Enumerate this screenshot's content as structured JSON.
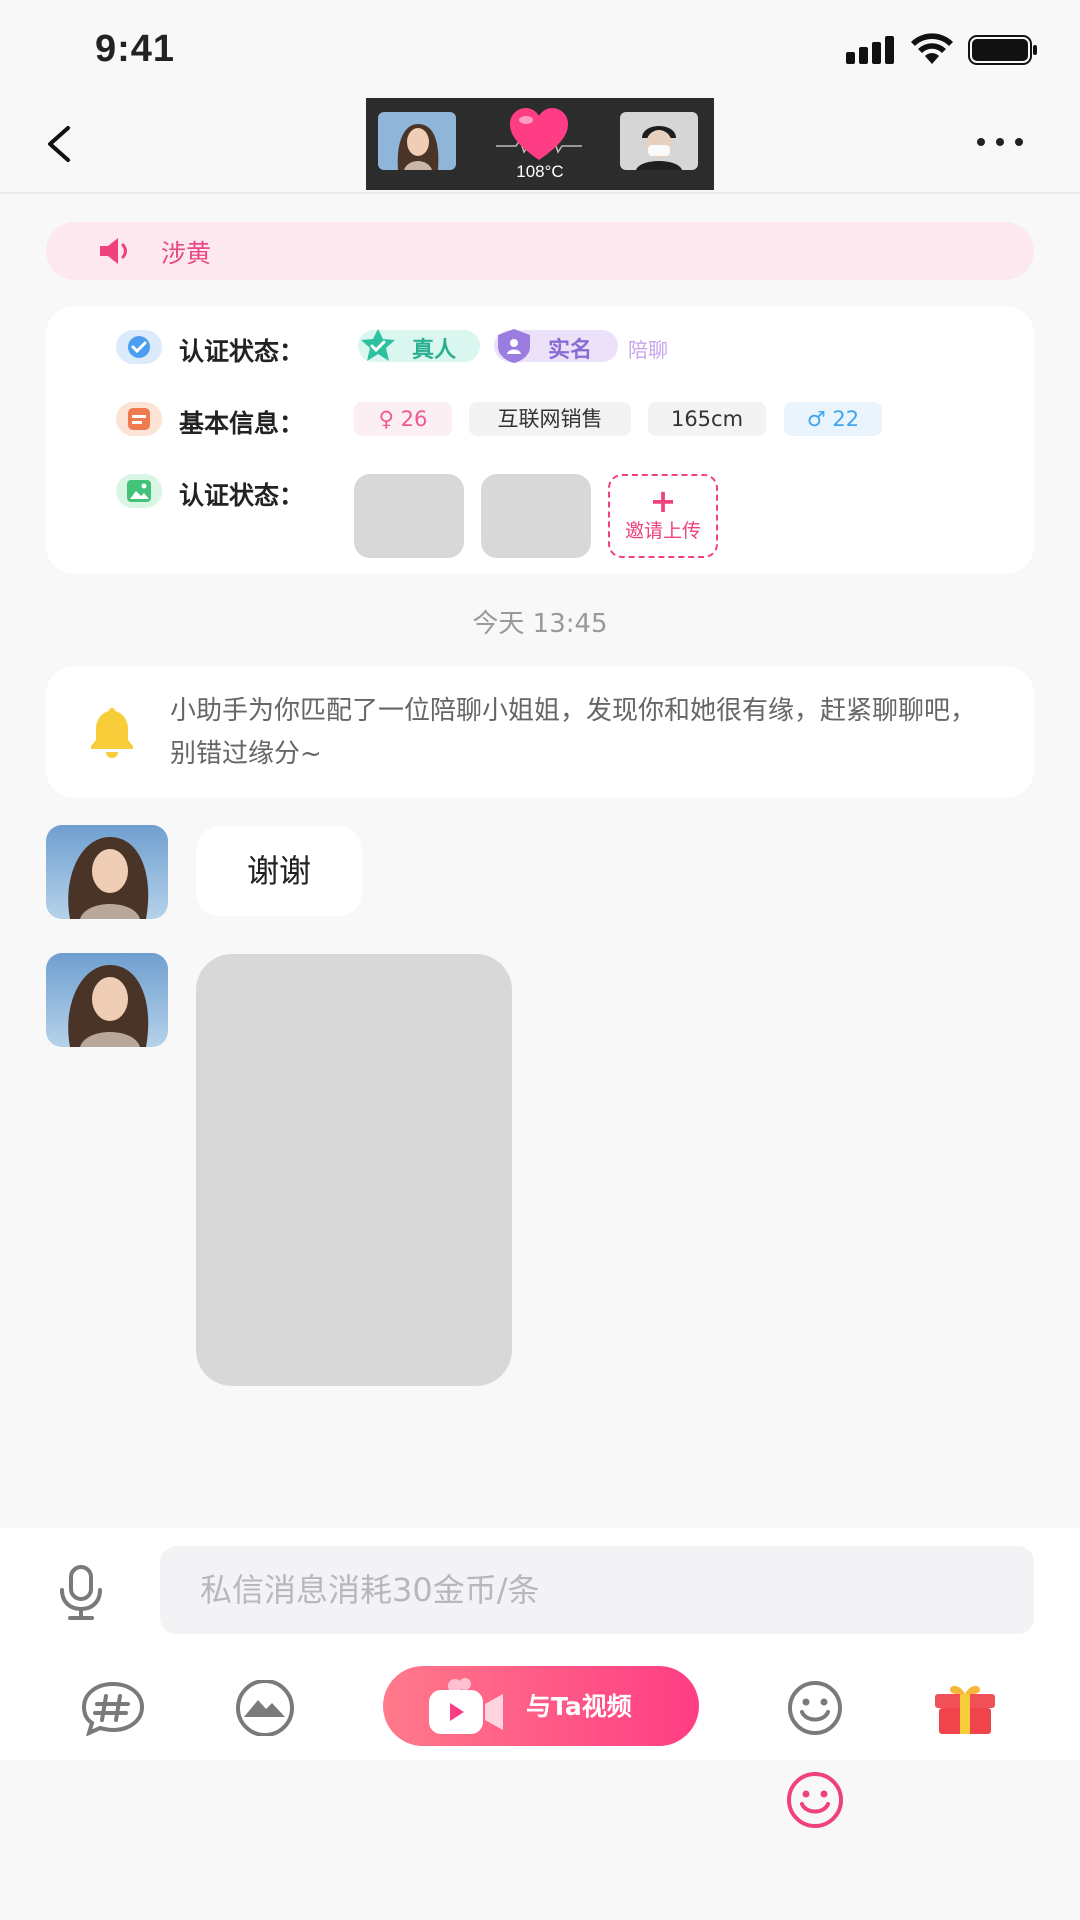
{
  "status_bar": {
    "time": "9:41"
  },
  "nav": {
    "temperature": "108°C"
  },
  "notice": {
    "text": "涉黄"
  },
  "info_card": {
    "rows": [
      {
        "label": "认证状态："
      },
      {
        "label": "基本信息："
      },
      {
        "label": "认证状态："
      }
    ],
    "badges": {
      "real_person": "真人",
      "real_name": "实名",
      "companion": "陪聊"
    },
    "basic_tags": {
      "female_age": "♀ 26",
      "job": "互联网销售",
      "height": "165cm",
      "male_age": "♂ 22"
    },
    "invite": {
      "plus": "+",
      "label": "邀请上传"
    }
  },
  "chat": {
    "timestamp": "今天 13:45",
    "assistant_message": "小助手为你匹配了一位陪聊小姐姐，发现你和她很有缘，赶紧聊聊吧，别错过缘分~",
    "messages": [
      {
        "text": "谢谢"
      }
    ]
  },
  "composer": {
    "placeholder": "私信消息消耗30金币/条",
    "video_button": "与Ta视频"
  },
  "colors": {
    "accent_pink": "#ff3d84",
    "notice_bg": "#fde8ef",
    "real_person_green": "#2cc2a0",
    "real_name_purple": "#9b7ce0",
    "male_blue": "#3fa6ee"
  }
}
